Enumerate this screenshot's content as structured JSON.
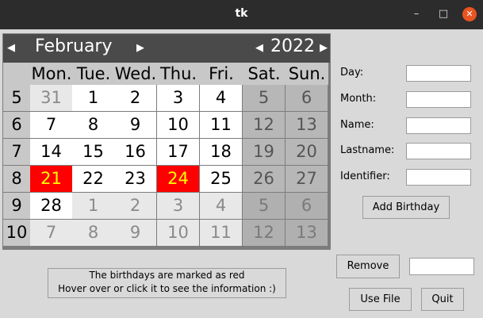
{
  "window": {
    "title": "tk"
  },
  "calendar": {
    "month": "February",
    "year": "2022",
    "weekday_headers": [
      "Mon.",
      "Tue.",
      "Wed.",
      "Thu.",
      "Fri.",
      "Sat.",
      "Sun."
    ],
    "weeks": [
      {
        "number": "5",
        "days": [
          "31",
          "1",
          "2",
          "3",
          "4",
          "5",
          "6"
        ],
        "other_month": [
          true,
          false,
          false,
          false,
          false,
          false,
          false
        ]
      },
      {
        "number": "6",
        "days": [
          "7",
          "8",
          "9",
          "10",
          "11",
          "12",
          "13"
        ],
        "other_month": [
          false,
          false,
          false,
          false,
          false,
          false,
          false
        ]
      },
      {
        "number": "7",
        "days": [
          "14",
          "15",
          "16",
          "17",
          "18",
          "19",
          "20"
        ],
        "other_month": [
          false,
          false,
          false,
          false,
          false,
          false,
          false
        ]
      },
      {
        "number": "8",
        "days": [
          "21",
          "22",
          "23",
          "24",
          "25",
          "26",
          "27"
        ],
        "other_month": [
          false,
          false,
          false,
          false,
          false,
          false,
          false
        ]
      },
      {
        "number": "9",
        "days": [
          "28",
          "1",
          "2",
          "3",
          "4",
          "5",
          "6"
        ],
        "other_month": [
          false,
          true,
          true,
          true,
          true,
          true,
          true
        ]
      },
      {
        "number": "10",
        "days": [
          "7",
          "8",
          "9",
          "10",
          "11",
          "12",
          "13"
        ],
        "other_month": [
          true,
          true,
          true,
          true,
          true,
          true,
          true
        ]
      }
    ],
    "birthdays": [
      "21",
      "24"
    ],
    "colors": {
      "birthday_bg": "#ff0000",
      "birthday_fg": "#ffff00",
      "header_bg": "#4a4a4a"
    }
  },
  "form": {
    "day_label": "Day:",
    "month_label": "Month:",
    "name_label": "Name:",
    "lastname_label": "Lastname:",
    "identifier_label": "Identifier:",
    "day_value": "",
    "month_value": "",
    "name_value": "",
    "lastname_value": "",
    "identifier_value": "",
    "remove_value": "",
    "add_birthday": "Add Birthday",
    "remove": "Remove",
    "use_file": "Use File",
    "quit": "Quit"
  },
  "info": {
    "line1": "The birthdays are marked as red",
    "line2": "Hover over or click it to see the information :)"
  }
}
